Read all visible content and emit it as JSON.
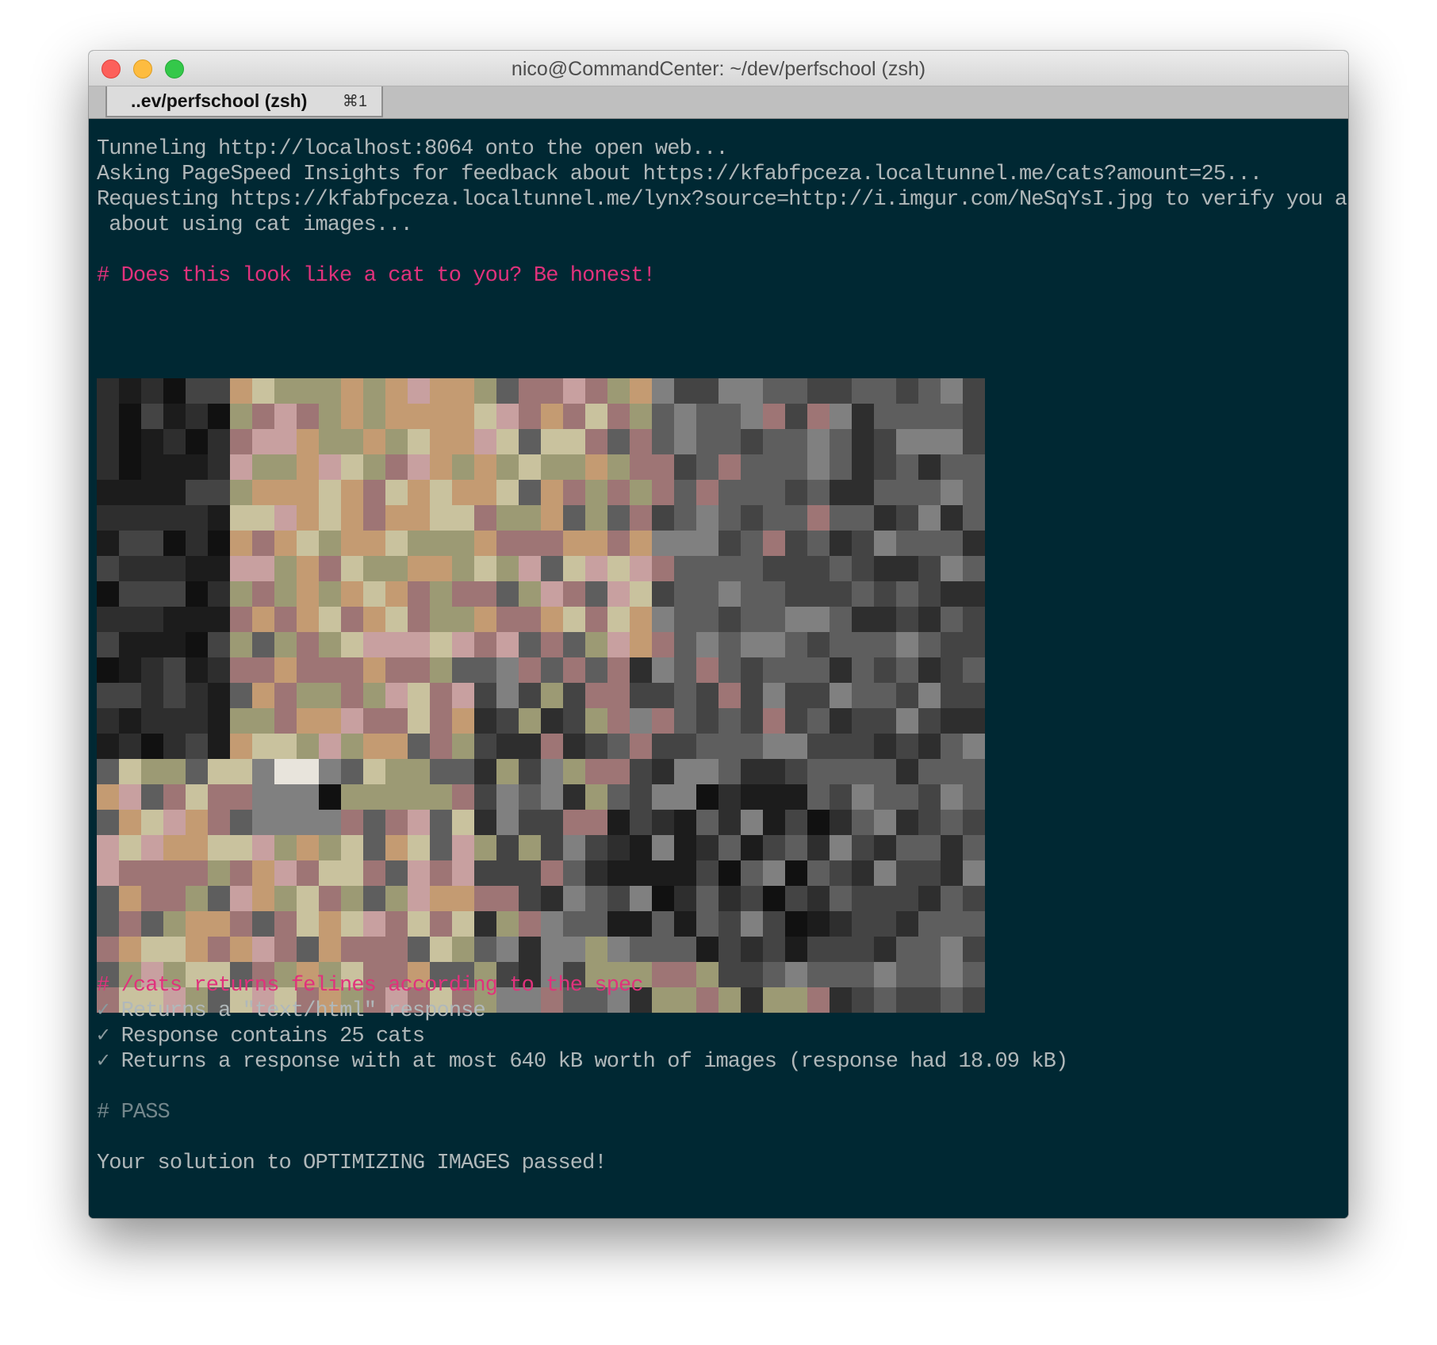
{
  "window": {
    "title": "nico@CommandCenter: ~/dev/perfschool (zsh)",
    "tab_label": "..ev/perfschool (zsh)",
    "tab_shortcut": "⌘1"
  },
  "colors": {
    "terminal_bg": "#002833",
    "text": "#b0b8ba",
    "heading": "#e0327c",
    "dim": "#74878c"
  },
  "output": {
    "line1": "Tunneling http://localhost:8064 onto the open web...",
    "line2": "Asking PageSpeed Insights for feedback about https://kfabfpceza.localtunnel.me/cats?amount=25...",
    "line3": "Requesting https://kfabfpceza.localtunnel.me/lynx?source=http://i.imgur.com/NeSqYsI.jpg to verify you are honest",
    "line4": " about using cat images...",
    "question": "# Does this look like a cat to you? Be honest!",
    "spec_heading": "# /cats returns felines according to the spec",
    "check_mark": "✓",
    "check1": "Returns a \"text/html\" response",
    "check2": "Response contains 25 cats",
    "check3": "Returns a response with at most 640 kB worth of images (response had 18.09 kB)",
    "pass": "# PASS",
    "result": "Your solution to OPTIMIZING IMAGES passed!"
  },
  "cat_image": {
    "description_icon": "pixelated-cat-image",
    "columns": 40,
    "rows": 25,
    "palette": [
      "#1c1c1c",
      "#2e2e2e",
      "#444444",
      "#5e5e5e",
      "#808080",
      "#9e7575",
      "#c49b72",
      "#9c9a74",
      "#c8a0a0",
      "#c9c29e",
      "#111111",
      "#e8e4dc"
    ]
  }
}
